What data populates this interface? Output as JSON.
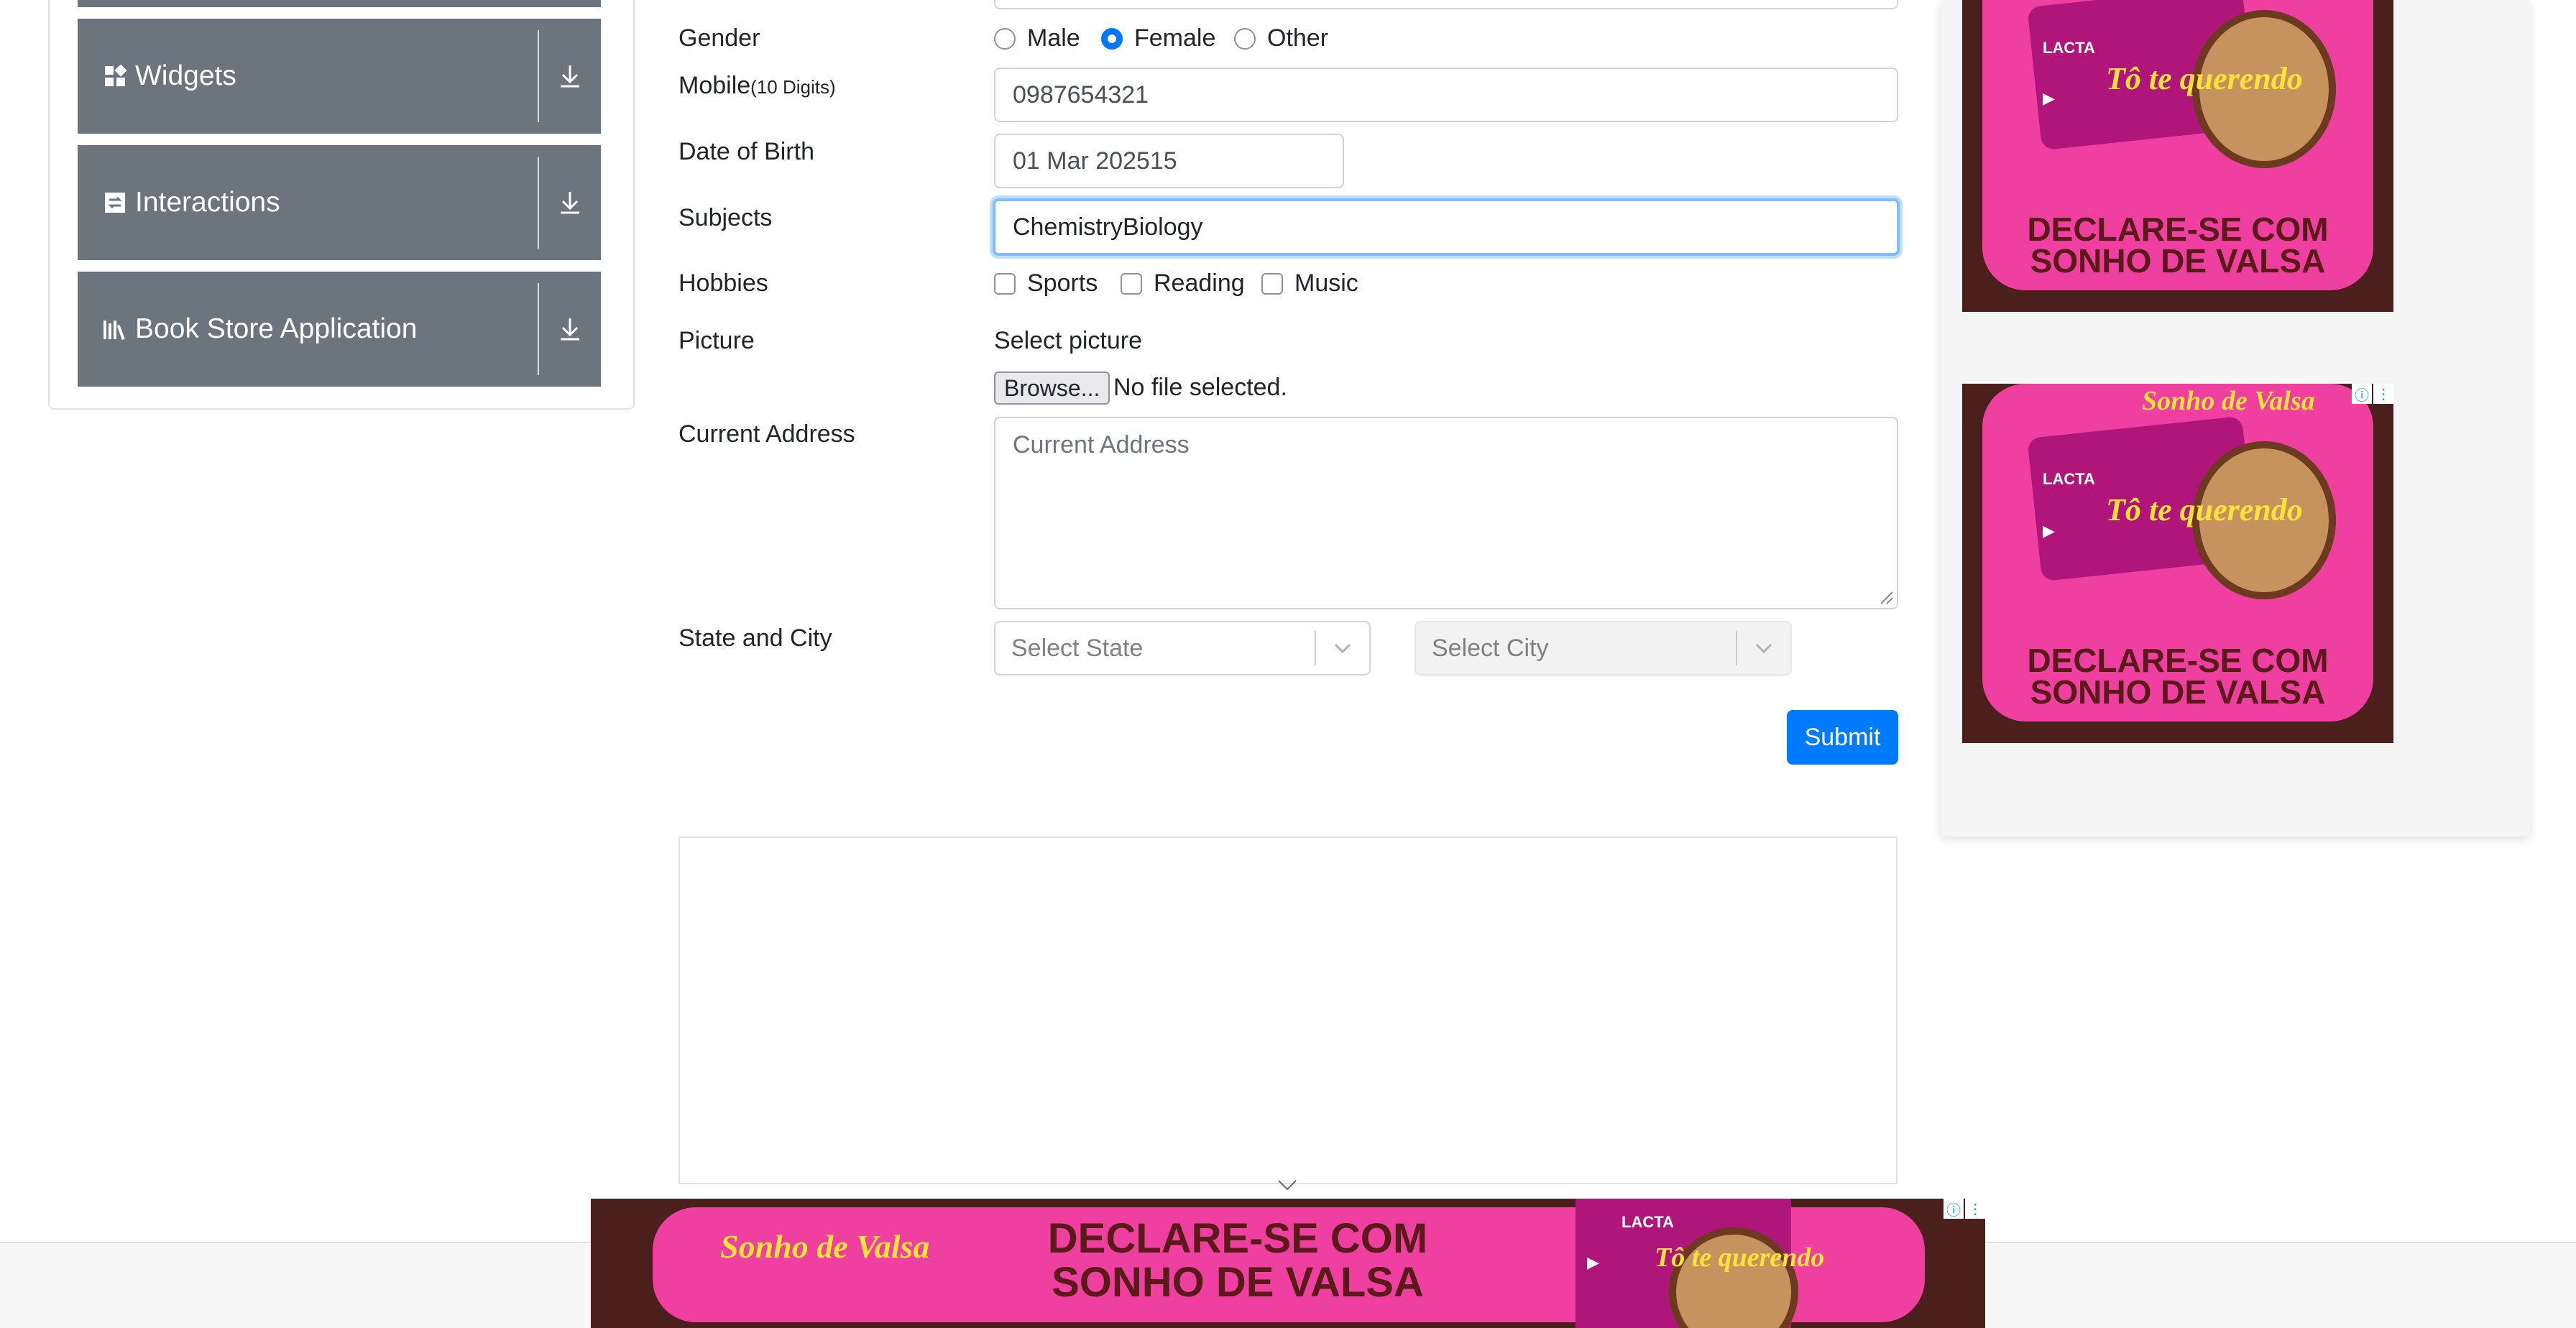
{
  "sidebar": {
    "groups": [
      {
        "label": "Widgets",
        "icon": "widgets-grid-icon"
      },
      {
        "label": "Interactions",
        "icon": "interactions-icon"
      },
      {
        "label": "Book Store Application",
        "icon": "bookstore-icon"
      }
    ]
  },
  "form": {
    "gender": {
      "label": "Gender",
      "options": [
        "Male",
        "Female",
        "Other"
      ],
      "selected": "Female"
    },
    "mobile": {
      "label": "Mobile",
      "note": "(10 Digits)",
      "value": "0987654321"
    },
    "dob": {
      "label": "Date of Birth",
      "value": "01 Mar 202515"
    },
    "subjects": {
      "label": "Subjects",
      "value": "ChemistryBiology"
    },
    "hobbies": {
      "label": "Hobbies",
      "options": [
        "Sports",
        "Reading",
        "Music"
      ]
    },
    "picture": {
      "label": "Picture",
      "caption": "Select picture",
      "button": "Browse...",
      "status": "No file selected."
    },
    "address": {
      "label": "Current Address",
      "placeholder": "Current Address"
    },
    "state_city": {
      "label": "State and City",
      "state_placeholder": "Select State",
      "city_placeholder": "Select City"
    },
    "submit": "Submit"
  },
  "ads": {
    "headline_line1": "DECLARE-SE COM",
    "headline_line2": "SONHO DE VALSA",
    "brand": "Sonho de Valsa",
    "pack_brand": "LACTA",
    "slogan": "Tô te querendo",
    "colors": {
      "pink": "#ef3fa0",
      "brown": "#4a1f1c",
      "yellow": "#ffe23a"
    }
  },
  "colors": {
    "accent": "#007bff",
    "sidebar_group": "#6c757d"
  }
}
